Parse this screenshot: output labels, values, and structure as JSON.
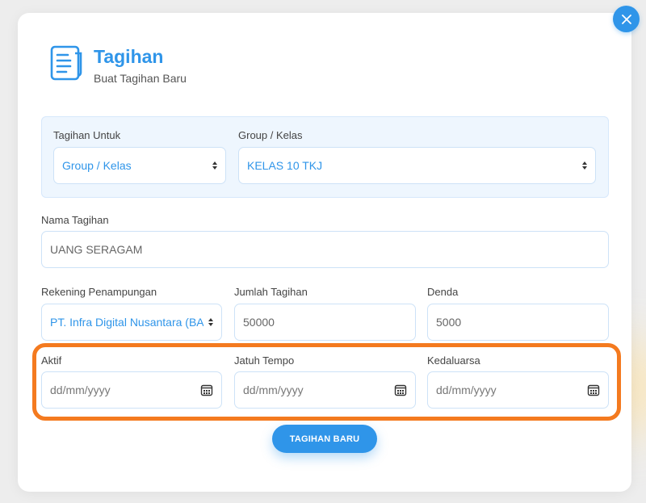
{
  "header": {
    "title": "Tagihan",
    "subtitle": "Buat Tagihan Baru",
    "icon": "document-icon"
  },
  "close_button": {
    "icon": "close-icon"
  },
  "form": {
    "tagihan_untuk": {
      "label": "Tagihan Untuk",
      "value": "Group / Kelas"
    },
    "group_kelas": {
      "label": "Group / Kelas",
      "value": "KELAS 10 TKJ"
    },
    "nama_tagihan": {
      "label": "Nama Tagihan",
      "value": "UANG SERAGAM"
    },
    "rekening": {
      "label": "Rekening Penampungan",
      "value": "PT. Infra Digital Nusantara (BA"
    },
    "jumlah": {
      "label": "Jumlah Tagihan",
      "value": "50000"
    },
    "denda": {
      "label": "Denda",
      "value": "5000"
    },
    "aktif": {
      "label": "Aktif",
      "placeholder": "dd/mm/yyyy"
    },
    "jatuh_tempo": {
      "label": "Jatuh Tempo",
      "placeholder": "dd/mm/yyyy"
    },
    "kedaluarsa": {
      "label": "Kedaluarsa",
      "placeholder": "dd/mm/yyyy"
    }
  },
  "submit_label": "TAGIHAN BARU",
  "colors": {
    "accent": "#2f95e9",
    "highlight": "#f47a1f"
  }
}
